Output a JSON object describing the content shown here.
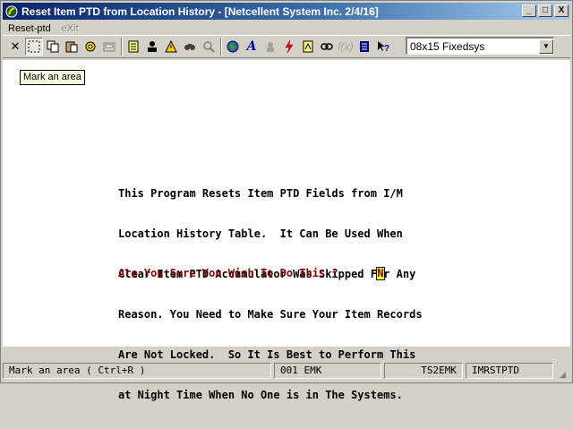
{
  "window": {
    "title": "Reset Item PTD from Location History - [Netcellent System Inc. 2/4/16]",
    "minimize_label": "_",
    "maximize_label": "□",
    "close_label": "X"
  },
  "menu": {
    "items": [
      {
        "label": "Reset-ptd",
        "enabled": true
      },
      {
        "label": "eXit",
        "enabled": false
      }
    ]
  },
  "toolbar": {
    "icons": [
      "close-icon",
      "mark-area-icon",
      "copy-icon",
      "paste-icon",
      "settings-icon",
      "print-setup-icon",
      "notes-icon",
      "user-icon",
      "alert-icon",
      "find-icon",
      "zoom-icon",
      "globe-icon",
      "font-icon",
      "contact-icon",
      "lightning-icon",
      "calculator-icon",
      "link-icon",
      "function-icon",
      "list-icon",
      "help-icon"
    ],
    "font_select_value": "08x15 Fixedsys"
  },
  "tooltip": {
    "text": "Mark an area"
  },
  "screen": {
    "message_lines": [
      "This Program Resets Item PTD Fields from I/M",
      "Location History Table.  It Can Be Used When",
      "Clear Item PTD Accumulator Was Skipped For Any",
      "Reason. You Need to Make Sure Your Item Records",
      "Are Not Locked.  So It Is Best to Perform This",
      "at Night Time When No One is in The Systems."
    ],
    "prompt": "Are You Sure You Wish To Do This ?",
    "answer": "N"
  },
  "status": {
    "hint": "Mark an area ( Ctrl+R )",
    "company": "001 EMK",
    "user": "TS2EMK",
    "program": "IMRSTPTD"
  },
  "colors": {
    "title_gradient_start": "#0a246a",
    "title_gradient_end": "#a6caf0",
    "prompt_text": "#800000",
    "answer_bg": "#ffff00"
  }
}
